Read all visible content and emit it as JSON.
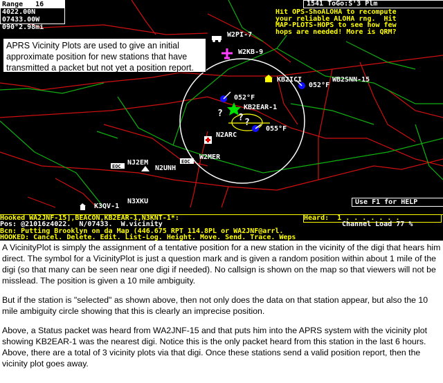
{
  "range_box": {
    "lines": [
      "Range   16",
      "4022.00N",
      "07433.00W",
      "090°2.98mi"
    ]
  },
  "top_right": {
    "title": "1541 ToGo:S'3 Plm",
    "message": [
      "Hit OPS-ShoALOHA to recompute",
      "your reliable ALOHA rng.  Hit",
      "MAP-PLOTS-HOPS to see how few",
      "hops are needed! More is QRM?"
    ]
  },
  "callout": {
    "text": "APRS Vicinity Plots are used to give an initial approximate position for new stations that have transmitted a packet but not yet a position report."
  },
  "stations": [
    {
      "call": "W2PI-7"
    },
    {
      "call": "W2KB-9"
    },
    {
      "call": "KB2ICI"
    },
    {
      "call": "WB2SNN-15"
    },
    {
      "call": "052°F"
    },
    {
      "call": "052°F"
    },
    {
      "call": "KB2EAR-1"
    },
    {
      "call": "055°F"
    },
    {
      "call": "N2ARC"
    },
    {
      "call": "W2MER"
    },
    {
      "call": "NJ2EM"
    },
    {
      "call": "N2UNH"
    },
    {
      "call": "N3XKU"
    },
    {
      "call": "K3QV-1"
    },
    {
      "call": "EOC"
    },
    {
      "call": "EOC"
    }
  ],
  "help_button": "Use F1 for HELP",
  "status": {
    "hooked": "Hooked WA2JNF-15],BEACON,KB2EAR-1,N3KNT-1*:",
    "heard": "Heard:  1 . . . . . . .",
    "pos": "Pos: @21016z4022.  N/07433.  W.vicinity",
    "channel_load": "Channel Load 77 %",
    "bcn": "Bcn: Putting Brooklyn on da Map (446.675 RPT 114.8PL or WA2JNF@arrl.",
    "menu": "HOOKED: Cancel. Delete. Edit. List-Log. Height. Move. Send. Trace. Weps"
  },
  "description": {
    "p1": "A VicinityPlot is simply the assignment of a tentative position for a new station in the vicinity of the digi that hears him direct.  The symbol for a VicinityPlot is just a question mark and is given a random position within about 1 mile of the digi (so that many can be seen near one digi if needed).  No callsign is shown on the map so that viewers will not be misslead.  The position is given a 10 mile ambiguity.",
    "p2": "But if the station is \"selected\" as shown above, then not only does the data on that station appear, but also the 10 mile ambiguity circle showing that this is clearly an imprecise position.",
    "p3": "Above, a Status packet was heard from WA2JNF-15 and that puts him into the APRS system with the vicinity plot showing KB2EAR-1 was the nearest digi.  Notice this is the only packet heard from this station in the last 6 hours.   Above, there are a total of 3 vicinity plots via that digi.  Once these stations send a valid position  report, then the vicinity plot goes away."
  },
  "colors": {
    "map_bg": "#000000",
    "roads": "#e00000",
    "boundaries": "#00c000",
    "highlight": "#ffff00",
    "circle": "#ffffff"
  }
}
